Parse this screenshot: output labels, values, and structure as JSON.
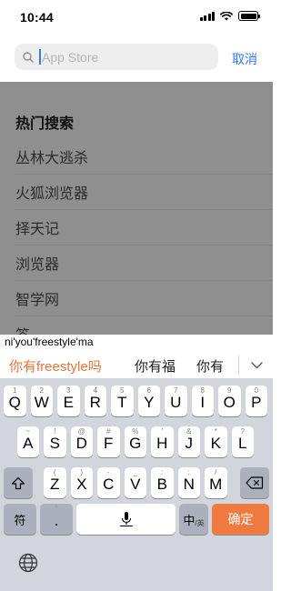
{
  "status_bar": {
    "time": "10:44"
  },
  "search": {
    "placeholder": "App Store",
    "value": "",
    "cancel_label": "取消"
  },
  "hot_search": {
    "title": "热门搜索",
    "items": [
      "丛林大逃杀",
      "火狐浏览器",
      "择天记",
      "浏览器",
      "智学网",
      "答"
    ]
  },
  "ime": {
    "composing": "ni'you'freestyle'ma",
    "candidates": [
      "你有freestyle吗",
      "你有福",
      "你有"
    ]
  },
  "keyboard": {
    "row1": [
      {
        "sub": "1",
        "main": "Q"
      },
      {
        "sub": "2",
        "main": "W"
      },
      {
        "sub": "3",
        "main": "E"
      },
      {
        "sub": "4",
        "main": "R"
      },
      {
        "sub": "5",
        "main": "T"
      },
      {
        "sub": "6",
        "main": "Y"
      },
      {
        "sub": "7",
        "main": "U"
      },
      {
        "sub": "8",
        "main": "I"
      },
      {
        "sub": "9",
        "main": "O"
      },
      {
        "sub": "0",
        "main": "P"
      }
    ],
    "row2": [
      {
        "sub": "~",
        "main": "A"
      },
      {
        "sub": "!",
        "main": "S"
      },
      {
        "sub": "@",
        "main": "D"
      },
      {
        "sub": "#",
        "main": "F"
      },
      {
        "sub": "%",
        "main": "G"
      },
      {
        "sub": "'",
        "main": "H"
      },
      {
        "sub": "&",
        "main": "J"
      },
      {
        "sub": "*",
        "main": "K"
      },
      {
        "sub": "?",
        "main": "L"
      }
    ],
    "row3": [
      {
        "sub": "(",
        "main": "Z"
      },
      {
        "sub": ")",
        "main": "X"
      },
      {
        "sub": "-",
        "main": "C"
      },
      {
        "sub": "_",
        "main": "V"
      },
      {
        "sub": ":",
        "main": "B"
      },
      {
        "sub": ";",
        "main": "N"
      },
      {
        "sub": "/",
        "main": "M"
      }
    ],
    "symbol_label": "符",
    "punct_sub": "'",
    "punct_main": ".",
    "lang_label": "中",
    "lang_sub": "/英",
    "confirm_label": "确定"
  },
  "colors": {
    "accent": "#2f7cf6",
    "candidate_highlight": "#e8743d",
    "confirm": "#f07a3f"
  }
}
